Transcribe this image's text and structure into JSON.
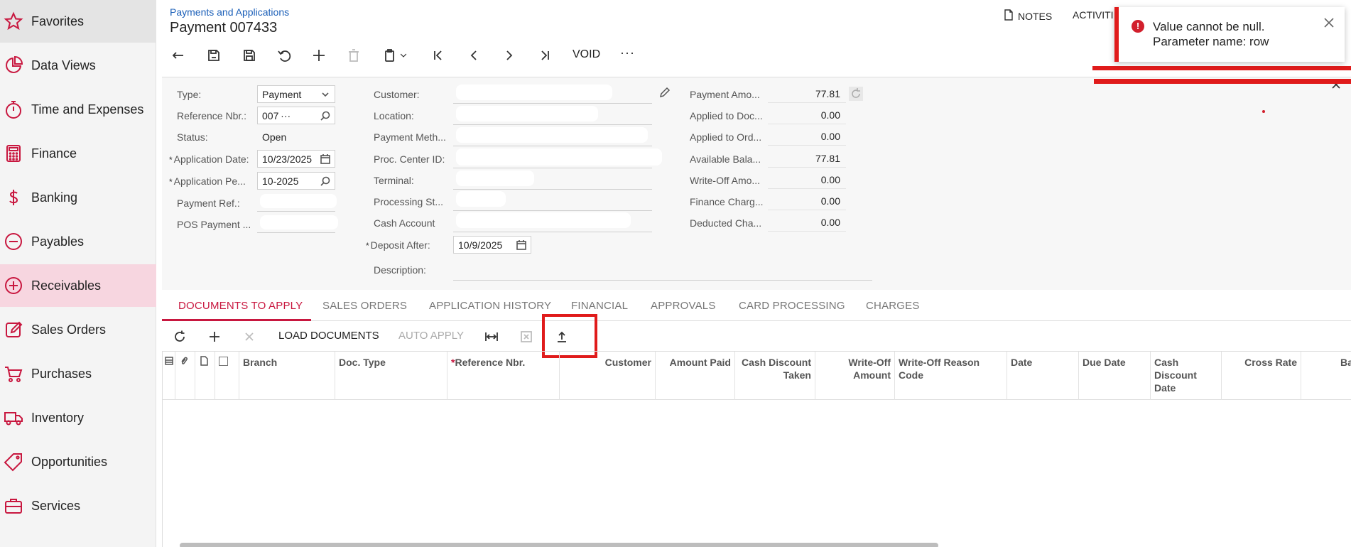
{
  "sidebar": {
    "items": [
      {
        "label": "Favorites",
        "icon": "star-icon"
      },
      {
        "label": "Data Views",
        "icon": "pie-chart-icon"
      },
      {
        "label": "Time and Expenses",
        "icon": "stopwatch-icon"
      },
      {
        "label": "Finance",
        "icon": "calculator-icon"
      },
      {
        "label": "Banking",
        "icon": "dollar-icon"
      },
      {
        "label": "Payables",
        "icon": "minus-circle-icon"
      },
      {
        "label": "Receivables",
        "icon": "plus-circle-icon"
      },
      {
        "label": "Sales Orders",
        "icon": "pencil-square-icon"
      },
      {
        "label": "Purchases",
        "icon": "cart-icon"
      },
      {
        "label": "Inventory",
        "icon": "truck-icon"
      },
      {
        "label": "Opportunities",
        "icon": "tag-icon"
      },
      {
        "label": "Services",
        "icon": "briefcase-icon"
      }
    ],
    "active": "Receivables"
  },
  "header": {
    "breadcrumb": "Payments and Applications",
    "title": "Payment 007433",
    "notes_label": "NOTES",
    "activities_label": "ACTIVITI"
  },
  "toolbar": {
    "void_label": "VOID",
    "more_label": "···"
  },
  "form": {
    "type_label": "Type:",
    "type_value": "Payment",
    "refnbr_label": "Reference Nbr.:",
    "refnbr_value": "007 ···",
    "status_label": "Status:",
    "status_value": "Open",
    "appdate_label": "Application Date:",
    "appdate_value": "10/23/2025",
    "appperiod_label": "Application Pe...",
    "appperiod_value": "10-2025",
    "payref_label": "Payment Ref.:",
    "pos_label": "POS Payment ...",
    "customer_label": "Customer:",
    "location_label": "Location:",
    "paymethod_label": "Payment Meth...",
    "proccenter_label": "Proc. Center ID:",
    "terminal_label": "Terminal:",
    "processing_label": "Processing St...",
    "cashaccount_label": "Cash Account",
    "deposit_label": "Deposit After:",
    "deposit_value": "10/9/2025",
    "description_label": "Description:",
    "amounts": [
      {
        "label": "Payment Amo...",
        "value": "77.81"
      },
      {
        "label": "Applied to Doc...",
        "value": "0.00"
      },
      {
        "label": "Applied to Ord...",
        "value": "0.00"
      },
      {
        "label": "Available Bala...",
        "value": "77.81"
      },
      {
        "label": "Write-Off Amo...",
        "value": "0.00"
      },
      {
        "label": "Finance Charg...",
        "value": "0.00"
      },
      {
        "label": "Deducted Cha...",
        "value": "0.00"
      }
    ]
  },
  "tabs": [
    "DOCUMENTS TO APPLY",
    "SALES ORDERS",
    "APPLICATION HISTORY",
    "FINANCIAL",
    "APPROVALS",
    "CARD PROCESSING",
    "CHARGES"
  ],
  "grid_toolbar": {
    "load_documents": "LOAD DOCUMENTS",
    "auto_apply": "AUTO APPLY"
  },
  "grid": {
    "columns": [
      "Branch",
      "Doc. Type",
      "Reference Nbr.",
      "Customer",
      "Amount Paid",
      "Cash Discount Taken",
      "Write-Off Amount",
      "Write-Off Reason Code",
      "Date",
      "Due Date",
      "Cash Discount Date",
      "Cross Rate",
      "Ba"
    ]
  },
  "toast": {
    "line1": "Value cannot be null.",
    "line2": "Parameter name: row"
  },
  "colors": {
    "accent": "#c8173f",
    "error": "#e01b1b",
    "active_nav": "#f7d6e0"
  }
}
